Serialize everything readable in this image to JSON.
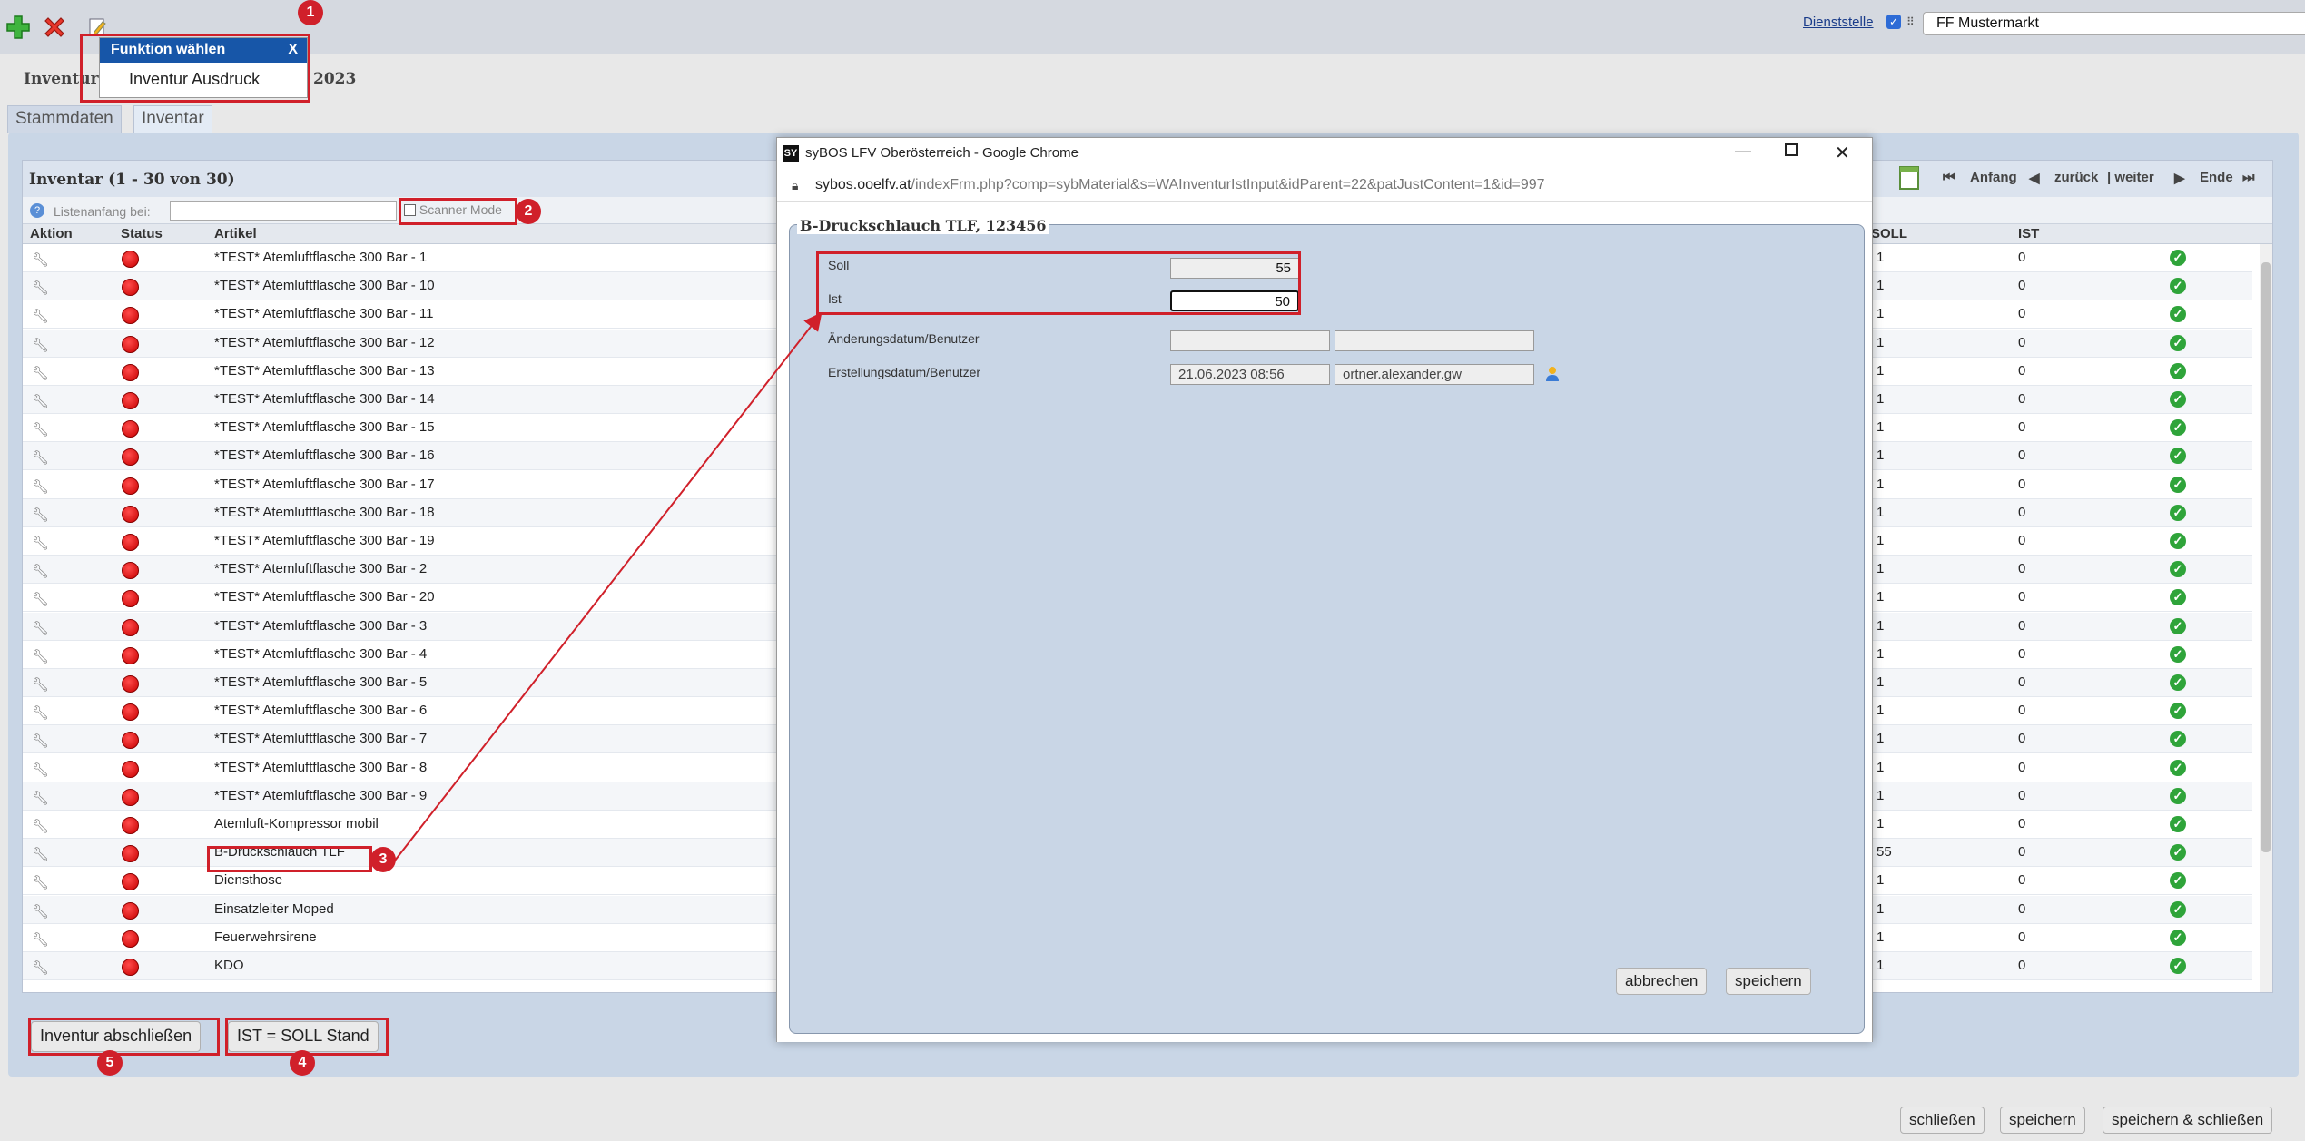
{
  "toolbar": {
    "dienststelle_label": "Dienststelle",
    "dienststelle_value": "FF Mustermarkt"
  },
  "page": {
    "title": "Inventur",
    "title_suffix": "2023"
  },
  "tabs": [
    {
      "label": "Stammdaten"
    },
    {
      "label": "Inventar"
    }
  ],
  "popup": {
    "title": "Funktion wählen",
    "close": "X",
    "item": "Inventur Ausdruck"
  },
  "list": {
    "title": "Inventar (1 - 30 von 30)",
    "filter_label": "Listenanfang bei:",
    "scanner_label": "Scanner Mode",
    "nav": {
      "first": "Anfang",
      "prev": "zurück",
      "next": "| weiter",
      "last": "Ende"
    },
    "columns": {
      "aktion": "Aktion",
      "status": "Status",
      "artikel": "Artikel",
      "soll": "SOLL",
      "ist": "IST"
    },
    "rows": [
      {
        "artikel": "*TEST* Atemluftflasche 300 Bar - 1",
        "soll": "1",
        "ist": "0"
      },
      {
        "artikel": "*TEST* Atemluftflasche 300 Bar - 10",
        "soll": "1",
        "ist": "0"
      },
      {
        "artikel": "*TEST* Atemluftflasche 300 Bar - 11",
        "soll": "1",
        "ist": "0"
      },
      {
        "artikel": "*TEST* Atemluftflasche 300 Bar - 12",
        "soll": "1",
        "ist": "0"
      },
      {
        "artikel": "*TEST* Atemluftflasche 300 Bar - 13",
        "soll": "1",
        "ist": "0"
      },
      {
        "artikel": "*TEST* Atemluftflasche 300 Bar - 14",
        "soll": "1",
        "ist": "0"
      },
      {
        "artikel": "*TEST* Atemluftflasche 300 Bar - 15",
        "soll": "1",
        "ist": "0"
      },
      {
        "artikel": "*TEST* Atemluftflasche 300 Bar - 16",
        "soll": "1",
        "ist": "0"
      },
      {
        "artikel": "*TEST* Atemluftflasche 300 Bar - 17",
        "soll": "1",
        "ist": "0"
      },
      {
        "artikel": "*TEST* Atemluftflasche 300 Bar - 18",
        "soll": "1",
        "ist": "0"
      },
      {
        "artikel": "*TEST* Atemluftflasche 300 Bar - 19",
        "soll": "1",
        "ist": "0"
      },
      {
        "artikel": "*TEST* Atemluftflasche 300 Bar - 2",
        "soll": "1",
        "ist": "0"
      },
      {
        "artikel": "*TEST* Atemluftflasche 300 Bar - 20",
        "soll": "1",
        "ist": "0"
      },
      {
        "artikel": "*TEST* Atemluftflasche 300 Bar - 3",
        "soll": "1",
        "ist": "0"
      },
      {
        "artikel": "*TEST* Atemluftflasche 300 Bar - 4",
        "soll": "1",
        "ist": "0"
      },
      {
        "artikel": "*TEST* Atemluftflasche 300 Bar - 5",
        "soll": "1",
        "ist": "0"
      },
      {
        "artikel": "*TEST* Atemluftflasche 300 Bar - 6",
        "soll": "1",
        "ist": "0"
      },
      {
        "artikel": "*TEST* Atemluftflasche 300 Bar - 7",
        "soll": "1",
        "ist": "0"
      },
      {
        "artikel": "*TEST* Atemluftflasche 300 Bar - 8",
        "soll": "1",
        "ist": "0"
      },
      {
        "artikel": "*TEST* Atemluftflasche 300 Bar - 9",
        "soll": "1",
        "ist": "0"
      },
      {
        "artikel": "Atemluft-Kompressor mobil",
        "soll": "1",
        "ist": "0"
      },
      {
        "artikel": "B-Druckschlauch TLF",
        "soll": "55",
        "ist": "0"
      },
      {
        "artikel": "Diensthose",
        "soll": "1",
        "ist": "0"
      },
      {
        "artikel": "Einsatzleiter Moped",
        "soll": "1",
        "ist": "0"
      },
      {
        "artikel": "Feuerwehrsirene",
        "soll": "1",
        "ist": "0"
      },
      {
        "artikel": "KDO",
        "soll": "1",
        "ist": "0"
      }
    ]
  },
  "bottom_buttons": {
    "abschliessen": "Inventur abschließen",
    "ist_soll": "IST = SOLL Stand"
  },
  "footer_buttons": {
    "schliessen": "schließen",
    "speichern": "speichern",
    "speichern_schliessen": "speichern & schließen"
  },
  "chrome": {
    "window_title": "syBOS LFV Oberösterreich - Google Chrome",
    "url_host": "sybos.ooelfv.at",
    "url_path": "/indexFrm.php?comp=sybMaterial&s=WAInventurIstInput&idParent=22&patJustContent=1&id=997",
    "logo": "SY"
  },
  "dialog": {
    "legend": "B-Druckschlauch TLF, 123456",
    "soll_label": "Soll",
    "soll_value": "55",
    "ist_label": "Ist",
    "ist_value": "50",
    "aenderung_label": "Änderungsdatum/Benutzer",
    "aenderung_date": "",
    "aenderung_user": "",
    "erstellung_label": "Erstellungsdatum/Benutzer",
    "erstellung_date": "21.06.2023 08:56",
    "erstellung_user": "ortner.alexander.gw",
    "abbrechen": "abbrechen",
    "speichern": "speichern"
  },
  "badges": [
    "1",
    "2",
    "3",
    "4",
    "5"
  ],
  "colors": {
    "highlight": "#d0202a",
    "status_red": "#e00000",
    "ok_green": "#2fa43a",
    "popup_header": "#1756a8"
  }
}
